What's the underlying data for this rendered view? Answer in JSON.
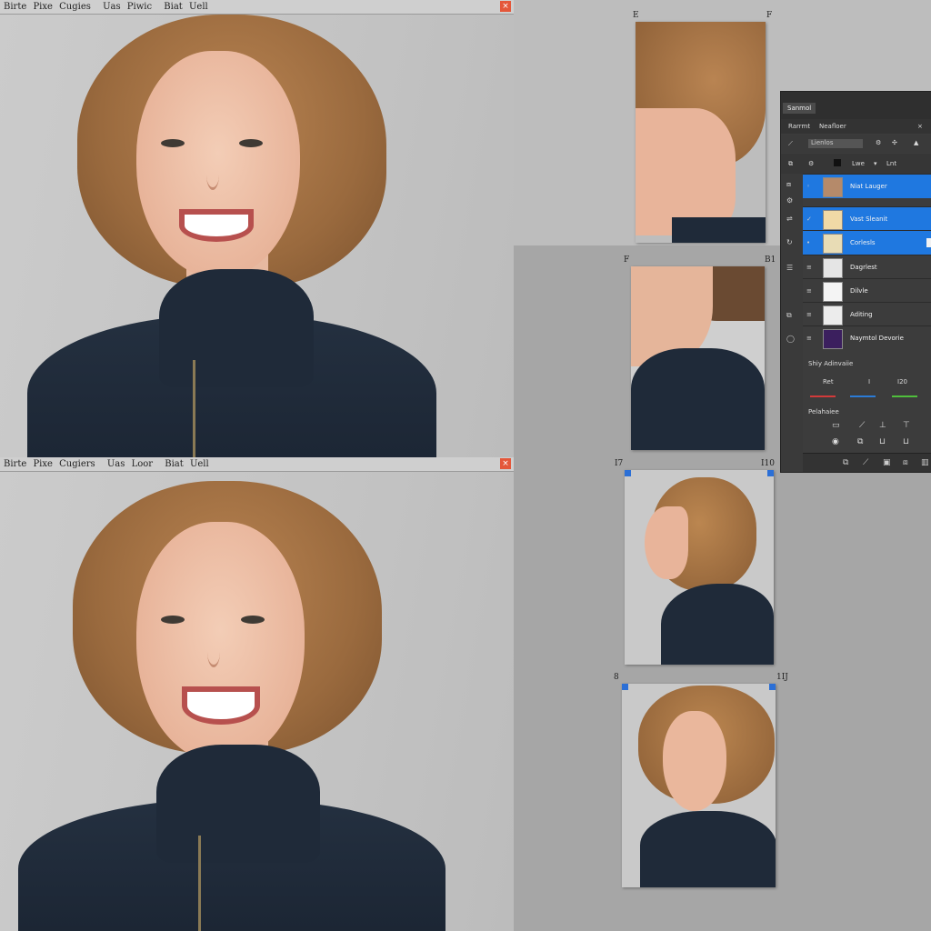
{
  "editor_top": {
    "menu": [
      "Birte",
      "Pixe",
      "Cugies",
      "Uas",
      "Piwic",
      "Biat",
      "Uell"
    ],
    "close_label": "×"
  },
  "editor_bottom": {
    "menu": [
      "Birte",
      "Pixe",
      "Cugiers",
      "Uas",
      "Loor",
      "Biat",
      "Uell"
    ],
    "close_label": "×"
  },
  "thumbs": {
    "t1": {
      "left_num": "E",
      "right_num": "F"
    },
    "t2": {
      "left_num": "F",
      "right_num": "B1"
    },
    "t3": {
      "left_num": "I7",
      "right_num": "I10"
    },
    "t4": {
      "left_num": "8",
      "right_num": "1IJ"
    }
  },
  "panel": {
    "tab": "Sanmol",
    "row2": [
      "Rarrmt",
      "Neafloer"
    ],
    "row3_field": "Lienlos",
    "row4": [
      "Lwe",
      "Lnt"
    ],
    "layers": [
      {
        "name": "Niat Lauger",
        "selected": true,
        "thumb_color": "#b58a6a"
      },
      {
        "name": "Vast Sleanit",
        "selected": true,
        "thumb_color": "#f1d9a6"
      },
      {
        "name": "Corlesls",
        "selected": true,
        "thumb_color": "#e8dcb5"
      },
      {
        "name": "Dagrlest",
        "selected": false,
        "thumb_color": "#e5e5e5"
      },
      {
        "name": "Dilvle",
        "selected": false,
        "thumb_color": "#f4f4f4"
      },
      {
        "name": "Aditing",
        "selected": false,
        "thumb_color": "#ececec"
      },
      {
        "name": "Naymtol Devorie",
        "selected": false,
        "thumb_color": "#3b1f5e"
      }
    ],
    "section1": "Shiy Adinvaiie",
    "section1_vals": [
      "Ret",
      "I",
      "I20"
    ],
    "section2": "Pelahaiee",
    "swatches": [
      "#d23a3a",
      "#2b7bd6",
      "#4fbf3c"
    ]
  }
}
